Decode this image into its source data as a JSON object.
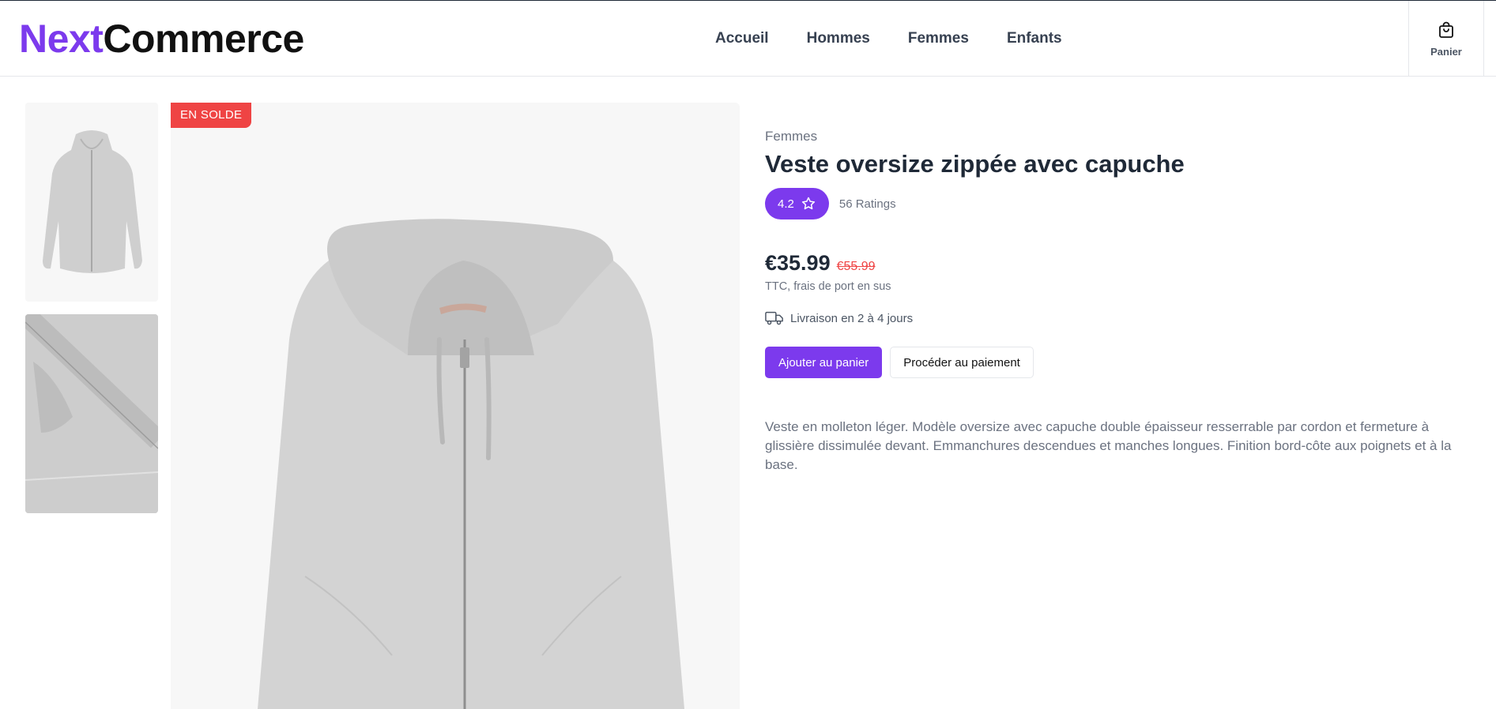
{
  "header": {
    "logo_brand": "Next",
    "logo_rest": "Commerce",
    "nav": [
      "Accueil",
      "Hommes",
      "Femmes",
      "Enfants"
    ],
    "cart_label": "Panier"
  },
  "gallery": {
    "badge": "EN SOLDE",
    "badge_color": "#ef4444"
  },
  "product": {
    "category": "Femmes",
    "title": "Veste oversize zippée avec capuche",
    "rating": "4.2",
    "ratings_count": "56 Ratings",
    "price": "€35.99",
    "old_price": "€55.99",
    "tax_note": "TTC, frais de port en sus",
    "delivery": "Livraison en 2 à 4 jours",
    "add_to_cart": "Ajouter au panier",
    "checkout": "Procéder au paiement",
    "description": "Veste en molleton léger. Modèle oversize avec capuche double épaisseur resserrable par cordon et fermeture à glissière dissimulée devant. Emmanchures descendues et manches longues. Finition bord-côte aux poignets et à la base."
  },
  "colors": {
    "accent": "#7c3aed",
    "sale": "#ef4444"
  }
}
